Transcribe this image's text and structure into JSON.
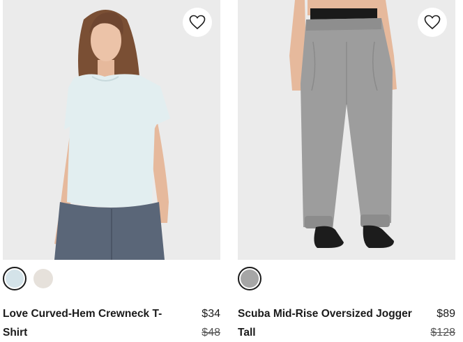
{
  "products": [
    {
      "name": "Love Curved-Hem Crewneck T-Shirt",
      "price": "$34",
      "original_price": "$48",
      "wishlist_icon": "heart-icon",
      "swatches": [
        {
          "color": "#d4e3e9",
          "selected": true
        },
        {
          "color": "#e6e1db",
          "selected": false
        }
      ]
    },
    {
      "name": "Scuba Mid-Rise Oversized Jogger Tall",
      "price": "$89",
      "original_price": "$128",
      "wishlist_icon": "heart-icon",
      "swatches": [
        {
          "color": "#a6a6a6",
          "selected": true
        }
      ]
    }
  ]
}
